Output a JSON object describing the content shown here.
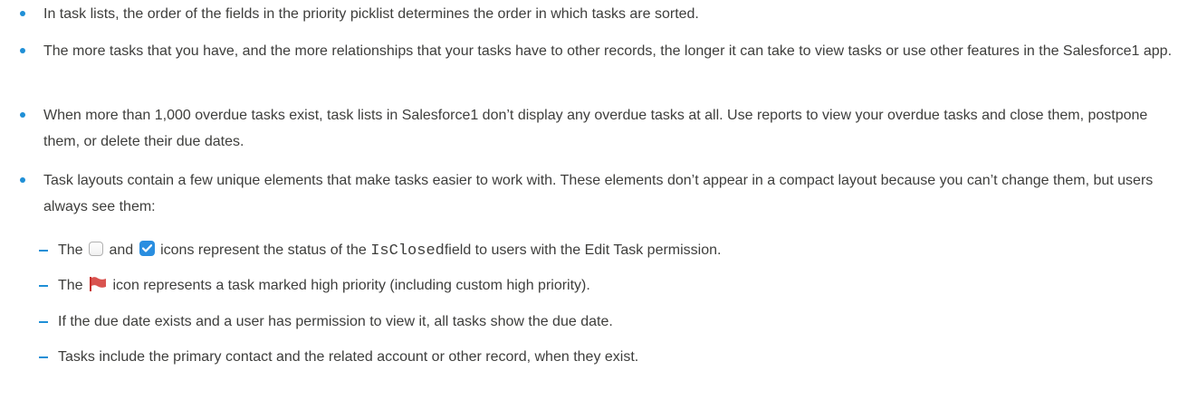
{
  "bullets": [
    "In task lists, the order of the fields in the priority picklist determines the order in which tasks are sorted.",
    "The more tasks that you have, and the more relationships that your tasks have to other records, the longer it can take to view tasks or use other features in the Salesforce1 app.",
    "When more than 1,000 overdue tasks exist, task lists in Salesforce1 don’t display any overdue tasks at all. Use reports to view your overdue tasks and close them, postpone them, or delete their due dates.",
    "Task layouts contain a few unique elements that make tasks easier to work with. These elements don’t appear in a compact layout because you can’t change them, but users always see them:"
  ],
  "sub_bullets": {
    "status_icons": {
      "prefix": "The",
      "middle": "and",
      "middle_after": "icons represent the status of the",
      "code": "IsClosed",
      "suffix": "field to users with the Edit Task permission."
    },
    "priority_icon": {
      "prefix": "The",
      "suffix": "icon represents a task marked high priority (including custom high priority)."
    },
    "due_date": "If the due date exists and a user has permission to view it, all tasks show the due date.",
    "contact": "Tasks include the primary contact and the related account or other record, when they exist."
  },
  "icons": {
    "empty_checkbox": "checkbox-unchecked-icon",
    "checked_checkbox": "checkbox-checked-icon",
    "priority_flag": "red-flag-icon"
  },
  "colors": {
    "bullet": "#1f8fd6",
    "text": "#3e3e3c",
    "flag": "#d9534f",
    "checkbox": "#2a8ee0"
  }
}
